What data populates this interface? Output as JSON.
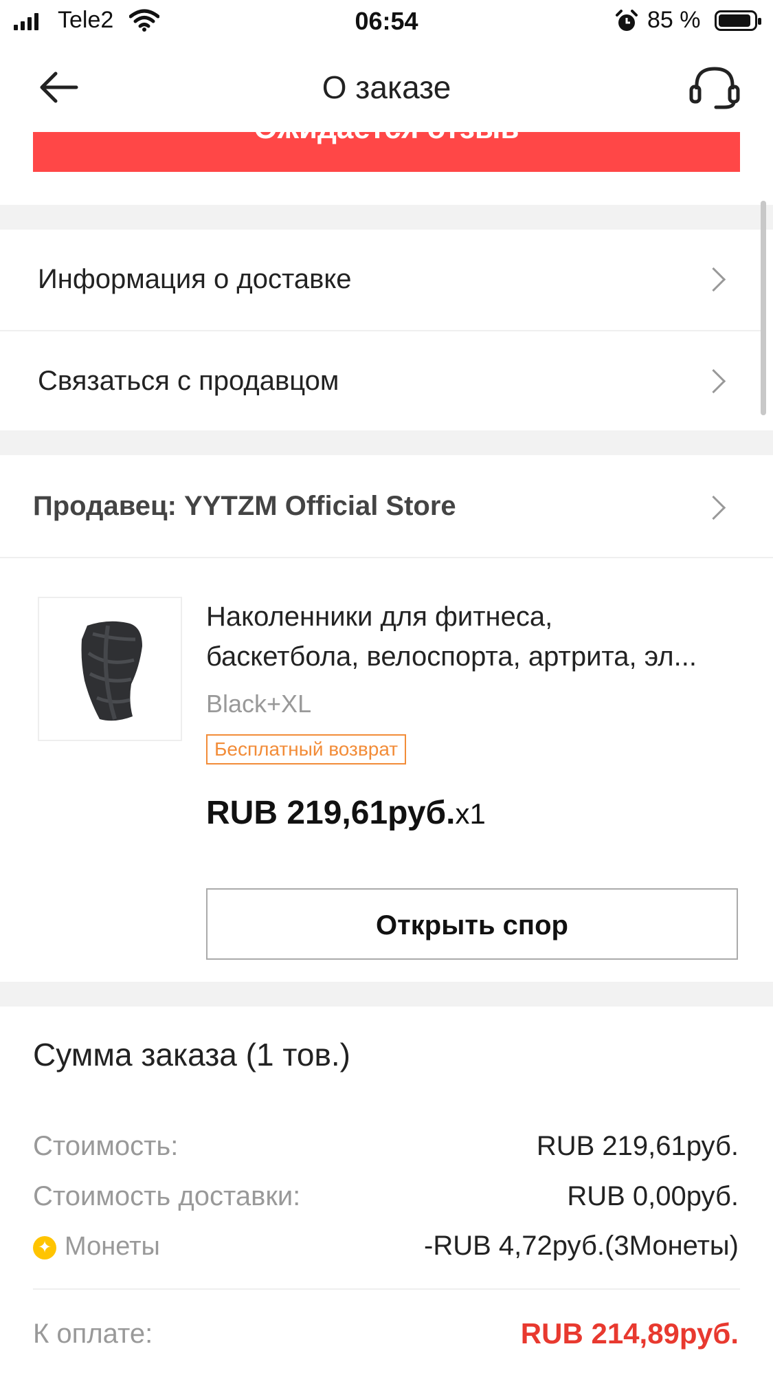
{
  "status_bar": {
    "carrier": "Tele2",
    "time": "06:54",
    "battery": "85 %"
  },
  "nav": {
    "title": "О заказе"
  },
  "banner": {
    "label": "Ожидается отзыв"
  },
  "menu": {
    "delivery_info": "Информация о доставке",
    "contact_seller": "Связаться с продавцом"
  },
  "store": {
    "label": "Продавец: YYTZM Official Store"
  },
  "product": {
    "title_line1": "Наколенники для фитнеса,",
    "title_line2": "баскетбола, велоспорта, артрита, эл...",
    "variant": "Black+XL",
    "badge": "Бесплатный возврат",
    "price": "RUB 219,61руб.",
    "qty": "x1",
    "dispute_button": "Открыть спор"
  },
  "summary": {
    "title": "Сумма заказа (1 тов.)",
    "rows": [
      {
        "label": "Стоимость:",
        "value": "RUB 219,61руб."
      },
      {
        "label": "Стоимость доставки:",
        "value": "RUB 0,00руб."
      },
      {
        "label": "Монеты",
        "value": "-RUB 4,72руб.(3Монеты)"
      }
    ],
    "total_label": "К оплате:",
    "total_value": "RUB 214,89руб."
  },
  "colors": {
    "accent": "#ff4747",
    "total": "#e8392f",
    "badge": "#f28c38",
    "coin": "#ffc400"
  },
  "icons": [
    "signal-icon",
    "wifi-icon",
    "alarm-icon",
    "battery-icon",
    "back-arrow-icon",
    "headset-icon",
    "chevron-right-icon",
    "coin-icon"
  ]
}
